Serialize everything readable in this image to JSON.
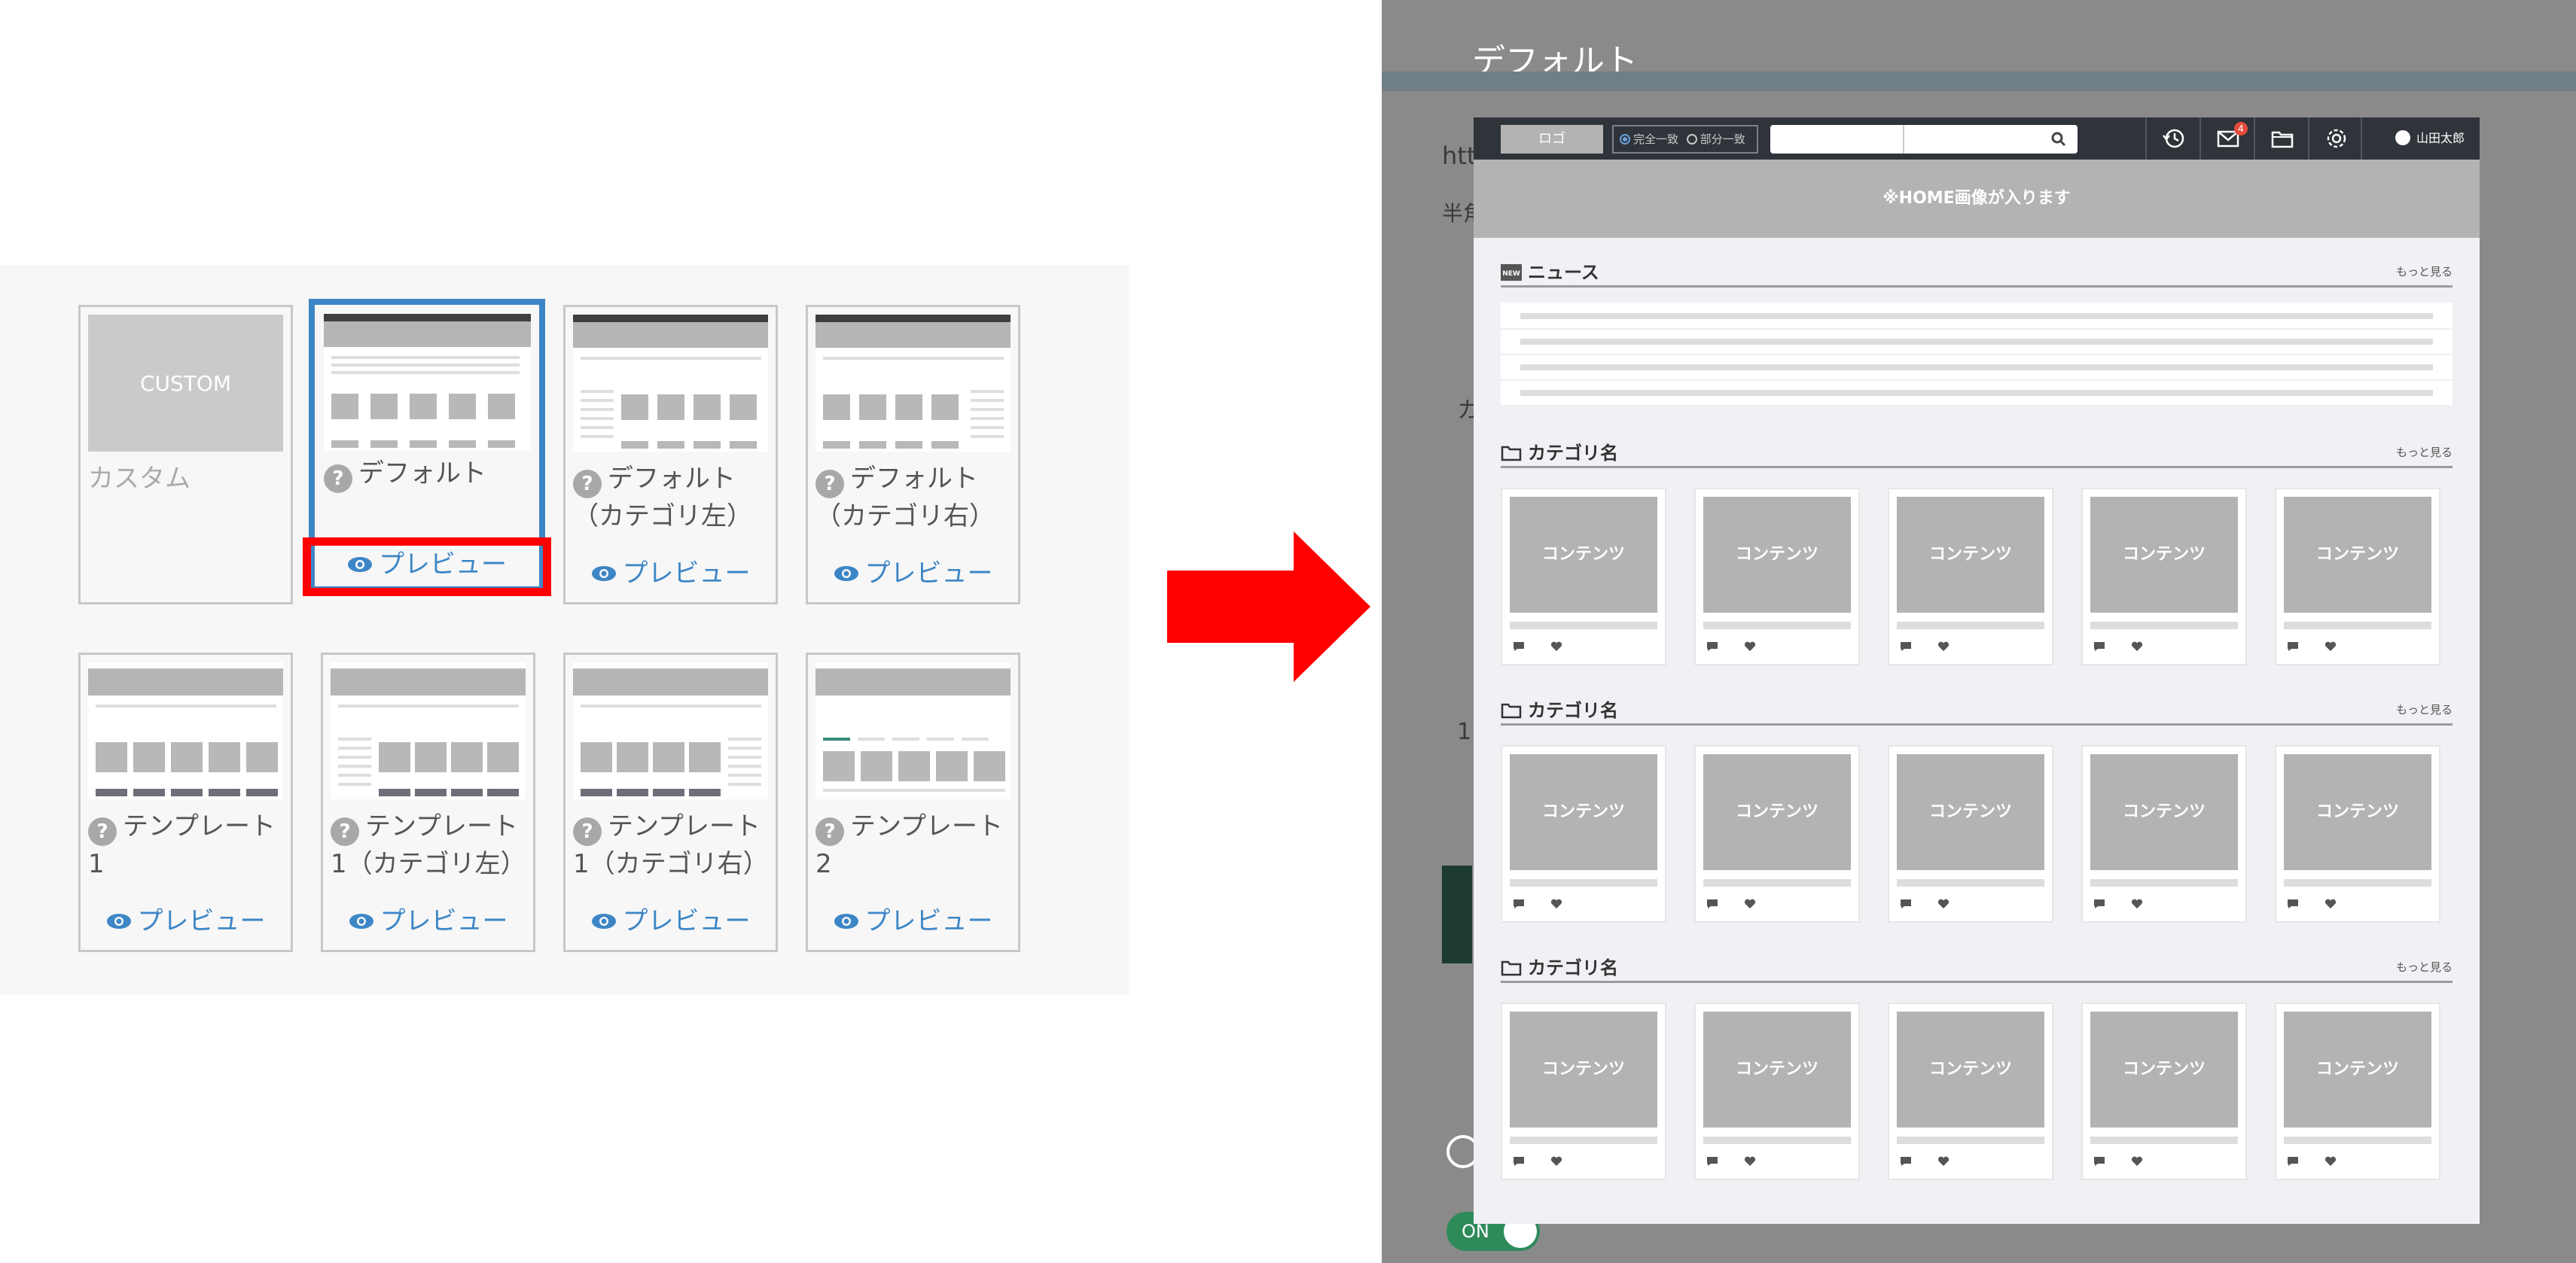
{
  "left": {
    "cards": [
      {
        "name": "カスタム",
        "thumb_label": "CUSTOM"
      },
      {
        "name": "デフォルト",
        "preview": "プレビュー"
      },
      {
        "name": "デフォルト（カテゴリ左）",
        "preview": "プレビュー"
      },
      {
        "name": "デフォルト（カテゴリ右）",
        "preview": "プレビュー"
      },
      {
        "name": "テンプレート1",
        "preview": "プレビュー"
      },
      {
        "name": "テンプレート1（カテゴリ左）",
        "preview": "プレビュー"
      },
      {
        "name": "テンプレート1（カテゴリ右）",
        "preview": "プレビュー"
      },
      {
        "name": "テンプレート2",
        "preview": "プレビュー"
      }
    ],
    "help_glyph": "?"
  },
  "right": {
    "title": "デフォルト",
    "bg_text_1": "htt",
    "bg_text_2": "半角",
    "bg_text_3": "カ",
    "bg_text_4": "1",
    "toggle": "ON",
    "preview": {
      "logo": "ロゴ",
      "match_full": "完全一致",
      "match_partial": "部分一致",
      "notification_count": "4",
      "user_name": "山田太郎",
      "hero": "※HOME画像が入ります",
      "news_title": "ニュース",
      "news_icon_label": "NEW",
      "more": "もっと見る",
      "category_title": "カテゴリ名",
      "content_label": "コンテンツ"
    }
  },
  "colors": {
    "selected_border": "#3d86c6",
    "highlight": "#ff0000",
    "link": "#3d86c6",
    "arrow": "#ff0000"
  }
}
